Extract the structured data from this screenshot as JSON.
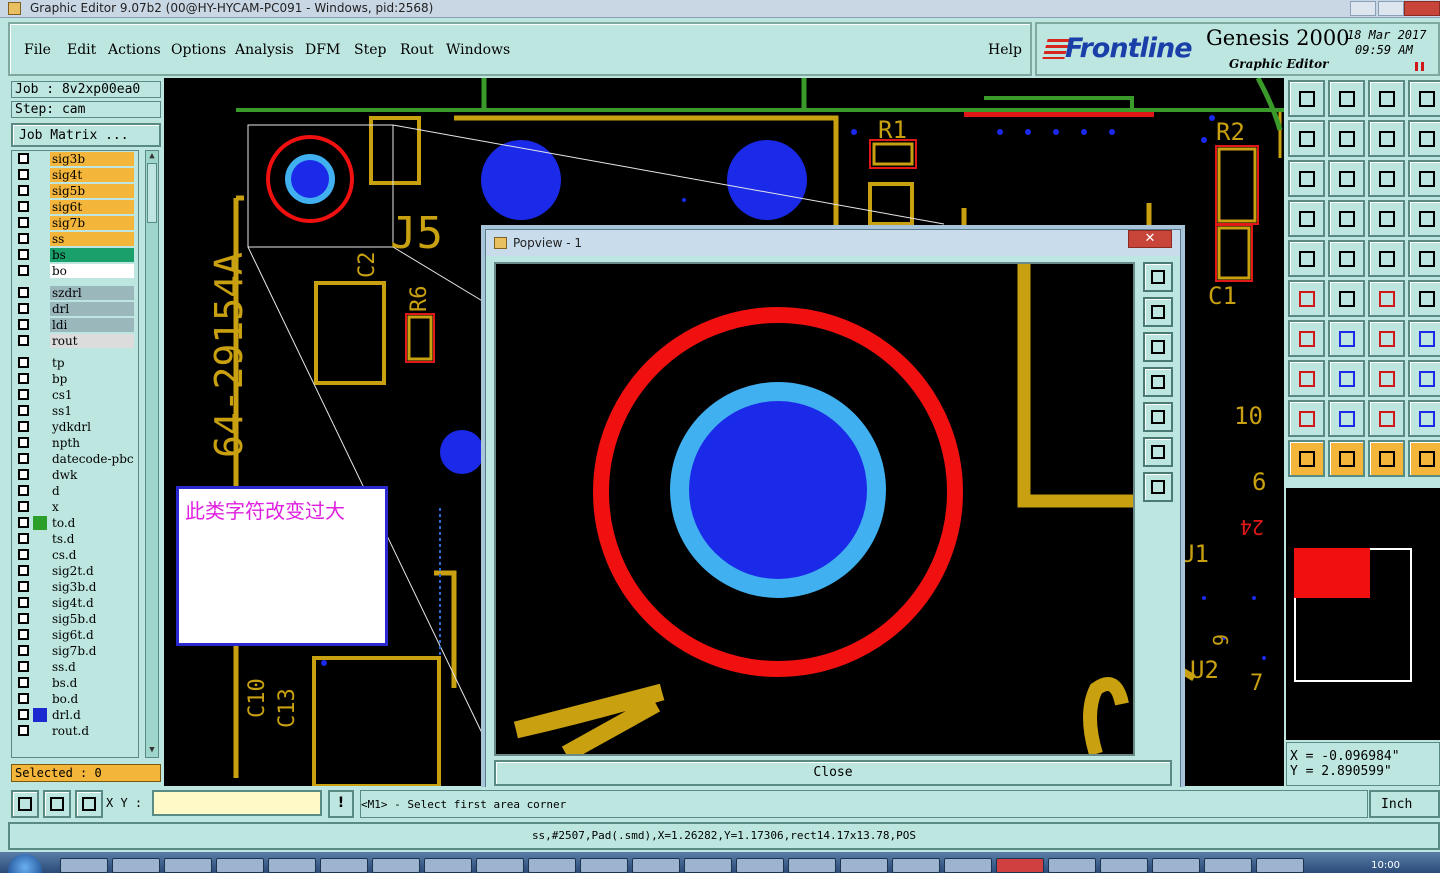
{
  "window": {
    "title": "Graphic Editor 9.07b2 (00@HY-HYCAM-PC091 - Windows, pid:2568)"
  },
  "menu": {
    "items": [
      "File",
      "Edit",
      "Actions",
      "Options",
      "Analysis",
      "DFM",
      "Step",
      "Rout",
      "Windows"
    ],
    "help": "Help"
  },
  "brand": {
    "logo": "Frontline",
    "product": "Genesis 2000",
    "subtitle": "Graphic Editor",
    "date": "18 Mar 2017",
    "time": "09:59 AM"
  },
  "job": {
    "job_line": "Job : 8v2xp00ea0",
    "step_line": "Step: cam",
    "matrix_button": "Job Matrix ..."
  },
  "layers": [
    {
      "name": "sig3b",
      "color": "#f3b53a",
      "mark": true
    },
    {
      "name": "sig4t",
      "color": "#f3b53a",
      "mark": true
    },
    {
      "name": "sig5b",
      "color": "#f3b53a",
      "mark": true
    },
    {
      "name": "sig6t",
      "color": "#f3b53a",
      "mark": true
    },
    {
      "name": "sig7b",
      "color": "#f3b53a",
      "mark": true
    },
    {
      "name": "ss",
      "color": "#f3b53a",
      "mark": true
    },
    {
      "name": "bs",
      "color": "#1aa06a",
      "mark": true
    },
    {
      "name": "bo",
      "color": "#ffffff",
      "mark": true
    },
    {
      "name": "szdrl",
      "color": "#9ab8bc",
      "mark": false
    },
    {
      "name": "drl",
      "color": "#9ab8bc",
      "mark": false
    },
    {
      "name": "ldi",
      "color": "#9ab8bc",
      "mark": false
    },
    {
      "name": "rout",
      "color": "#dcdcdc",
      "mark": false
    },
    {
      "name": "tp",
      "color": "#bde6e0",
      "mark": false
    },
    {
      "name": "bp",
      "color": "#bde6e0",
      "mark": false
    },
    {
      "name": "cs1",
      "color": "#bde6e0",
      "mark": false
    },
    {
      "name": "ss1",
      "color": "#bde6e0",
      "mark": false
    },
    {
      "name": "ydkdrl",
      "color": "#bde6e0",
      "mark": false
    },
    {
      "name": "npth",
      "color": "#bde6e0",
      "mark": false
    },
    {
      "name": "datecode-pbc",
      "color": "#bde6e0",
      "mark": false
    },
    {
      "name": "dwk",
      "color": "#bde6e0",
      "mark": false
    },
    {
      "name": "d",
      "color": "#bde6e0",
      "mark": false
    },
    {
      "name": "x",
      "color": "#bde6e0",
      "mark": false
    },
    {
      "name": "to.d",
      "color": "#bde6e0",
      "mark": true,
      "swatch": "#2aa02a"
    },
    {
      "name": "ts.d",
      "color": "#bde6e0",
      "mark": true
    },
    {
      "name": "cs.d",
      "color": "#bde6e0",
      "mark": true
    },
    {
      "name": "sig2t.d",
      "color": "#bde6e0",
      "mark": true
    },
    {
      "name": "sig3b.d",
      "color": "#bde6e0",
      "mark": true
    },
    {
      "name": "sig4t.d",
      "color": "#bde6e0",
      "mark": true
    },
    {
      "name": "sig5b.d",
      "color": "#bde6e0",
      "mark": true
    },
    {
      "name": "sig6t.d",
      "color": "#bde6e0",
      "mark": true
    },
    {
      "name": "sig7b.d",
      "color": "#bde6e0",
      "mark": true
    },
    {
      "name": "ss.d",
      "color": "#bde6e0",
      "mark": true
    },
    {
      "name": "bs.d",
      "color": "#bde6e0",
      "mark": true
    },
    {
      "name": "bo.d",
      "color": "#bde6e0",
      "mark": true
    },
    {
      "name": "drl.d",
      "color": "#bde6e0",
      "mark": true,
      "swatch": "#1a2ad0"
    },
    {
      "name": "rout.d",
      "color": "#bde6e0",
      "mark": false
    }
  ],
  "selected_text": "Selected : 0",
  "board_labels": {
    "part_number": "64-29154A",
    "j5": "J5",
    "c2": "C2",
    "r6": "R6",
    "r1": "R1",
    "r2": "R2",
    "c1": "C1",
    "c10": "C10",
    "c13": "C13",
    "u1": "U1",
    "u2": "U2",
    "ten": "10",
    "six": "6",
    "nine": "9",
    "twentyfour": "24",
    "seven": "7"
  },
  "annotation_note": "此类字符改变过大",
  "popview": {
    "title": "Popview - 1",
    "close_label": "Close",
    "close_x": "✕"
  },
  "coords": {
    "x_line": "X = -0.096984\"",
    "y_line": "Y = 2.890599\""
  },
  "bottom": {
    "xy_label": "X Y :",
    "xy_value": "",
    "exclaim": "!",
    "prompt": "<M1> - Select first area corner",
    "unit": "Inch"
  },
  "status_line": "ss,#2507,Pad(.smd),X=1.26282,Y=1.17306,rect14.17x13.78,POS",
  "taskbar": {
    "clock": "10:00"
  },
  "colors": {
    "panel": "#bde6e0",
    "trace": "#c8a010",
    "pad_blue": "#1a2ae8",
    "ring_red": "#f01010",
    "ring_cyan": "#40b0f0",
    "green_line": "#3a9a2a"
  }
}
